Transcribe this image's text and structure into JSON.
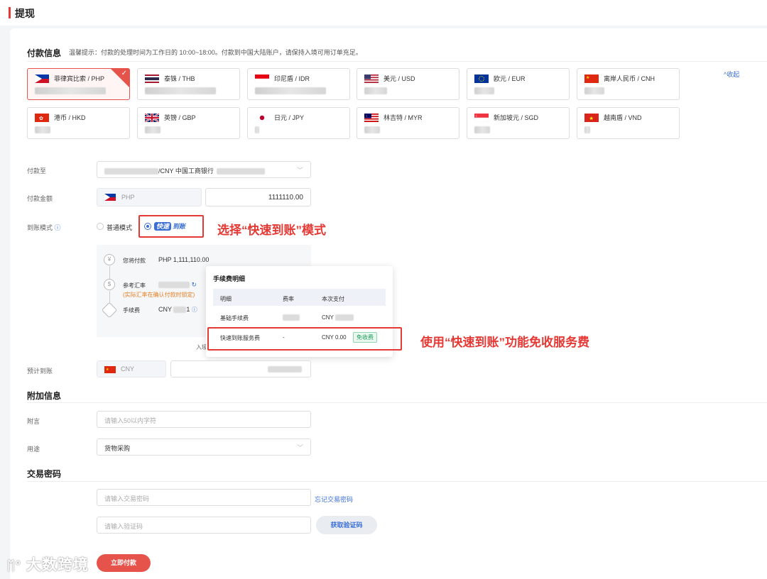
{
  "header": {
    "title": "提现"
  },
  "payment_info": {
    "title": "付款信息",
    "tip": "温馨提示：付款的处理时间为工作日的 10:00~18:00。付款到中国大陆账户，请保持入境可用订单充足。",
    "collapse_label": "^收起",
    "currencies": [
      {
        "name": "菲律宾比索 / PHP",
        "flag": "ph-flag"
      },
      {
        "name": "泰铢 / THB",
        "flag": "th-flag"
      },
      {
        "name": "印尼盾 / IDR",
        "flag": "id-flag"
      },
      {
        "name": "美元 / USD",
        "flag": "us-flag"
      },
      {
        "name": "欧元 / EUR",
        "flag": "eu-flag"
      },
      {
        "name": "离岸人民币 / CNH",
        "flag": "cn-flag"
      },
      {
        "name": "港币 / HKD",
        "flag": "hk-flag"
      },
      {
        "name": "英镑 / GBP",
        "flag": "gb-flag"
      },
      {
        "name": "日元 / JPY",
        "flag": "jp-flag"
      },
      {
        "name": "林吉特 / MYR",
        "flag": "my-flag"
      },
      {
        "name": "新加坡元 / SGD",
        "flag": "sg-flag"
      },
      {
        "name": "越南盾 / VND",
        "flag": "vn-flag"
      }
    ]
  },
  "form": {
    "pay_to_label": "付款至",
    "pay_to_value": "/CNY 中国工商银行",
    "amount_label": "付款金额",
    "amount_currency": "PHP",
    "amount_value": "1111110.00",
    "mode_label": "到账模式",
    "mode_normal": "普通模式",
    "mode_fast_a": "快速",
    "mode_fast_b": "到账",
    "expected_label": "预计到账",
    "expected_currency": "CNY"
  },
  "detail": {
    "you_pay_label": "您将付款",
    "you_pay_value": "PHP 1,111,110.00",
    "rate_label": "参考汇率",
    "rate_note": "(实际汇率在确认付款时锁定)",
    "fee_label": "手续费",
    "fee_value": "CNY",
    "fee_suffix": "1",
    "bottom_text": "入境"
  },
  "fee_popup": {
    "title": "手续费明细",
    "headers": [
      "明细",
      "费率",
      "本次支付"
    ],
    "rows": [
      {
        "item": "基础手续费",
        "rate": "",
        "pay": "CNY"
      },
      {
        "item": "快速到账服务费",
        "rate": "-",
        "pay": "CNY 0.00",
        "tag": "免收费"
      }
    ]
  },
  "annotations": {
    "a1": "选择“快速到账”模式",
    "a2": "使用“快速到账”功能免收服务费"
  },
  "extra": {
    "title": "附加信息",
    "note_label": "附言",
    "note_placeholder": "请输入50以内字符",
    "purpose_label": "用途",
    "purpose_value": "货物采购"
  },
  "password": {
    "title": "交易密码",
    "pwd_placeholder": "请输入交易密码",
    "forgot": "忘记交易密码",
    "code_placeholder": "请输入验证码",
    "get_code": "获取验证码",
    "submit": "立即付款"
  },
  "watermark": "大数跨境"
}
